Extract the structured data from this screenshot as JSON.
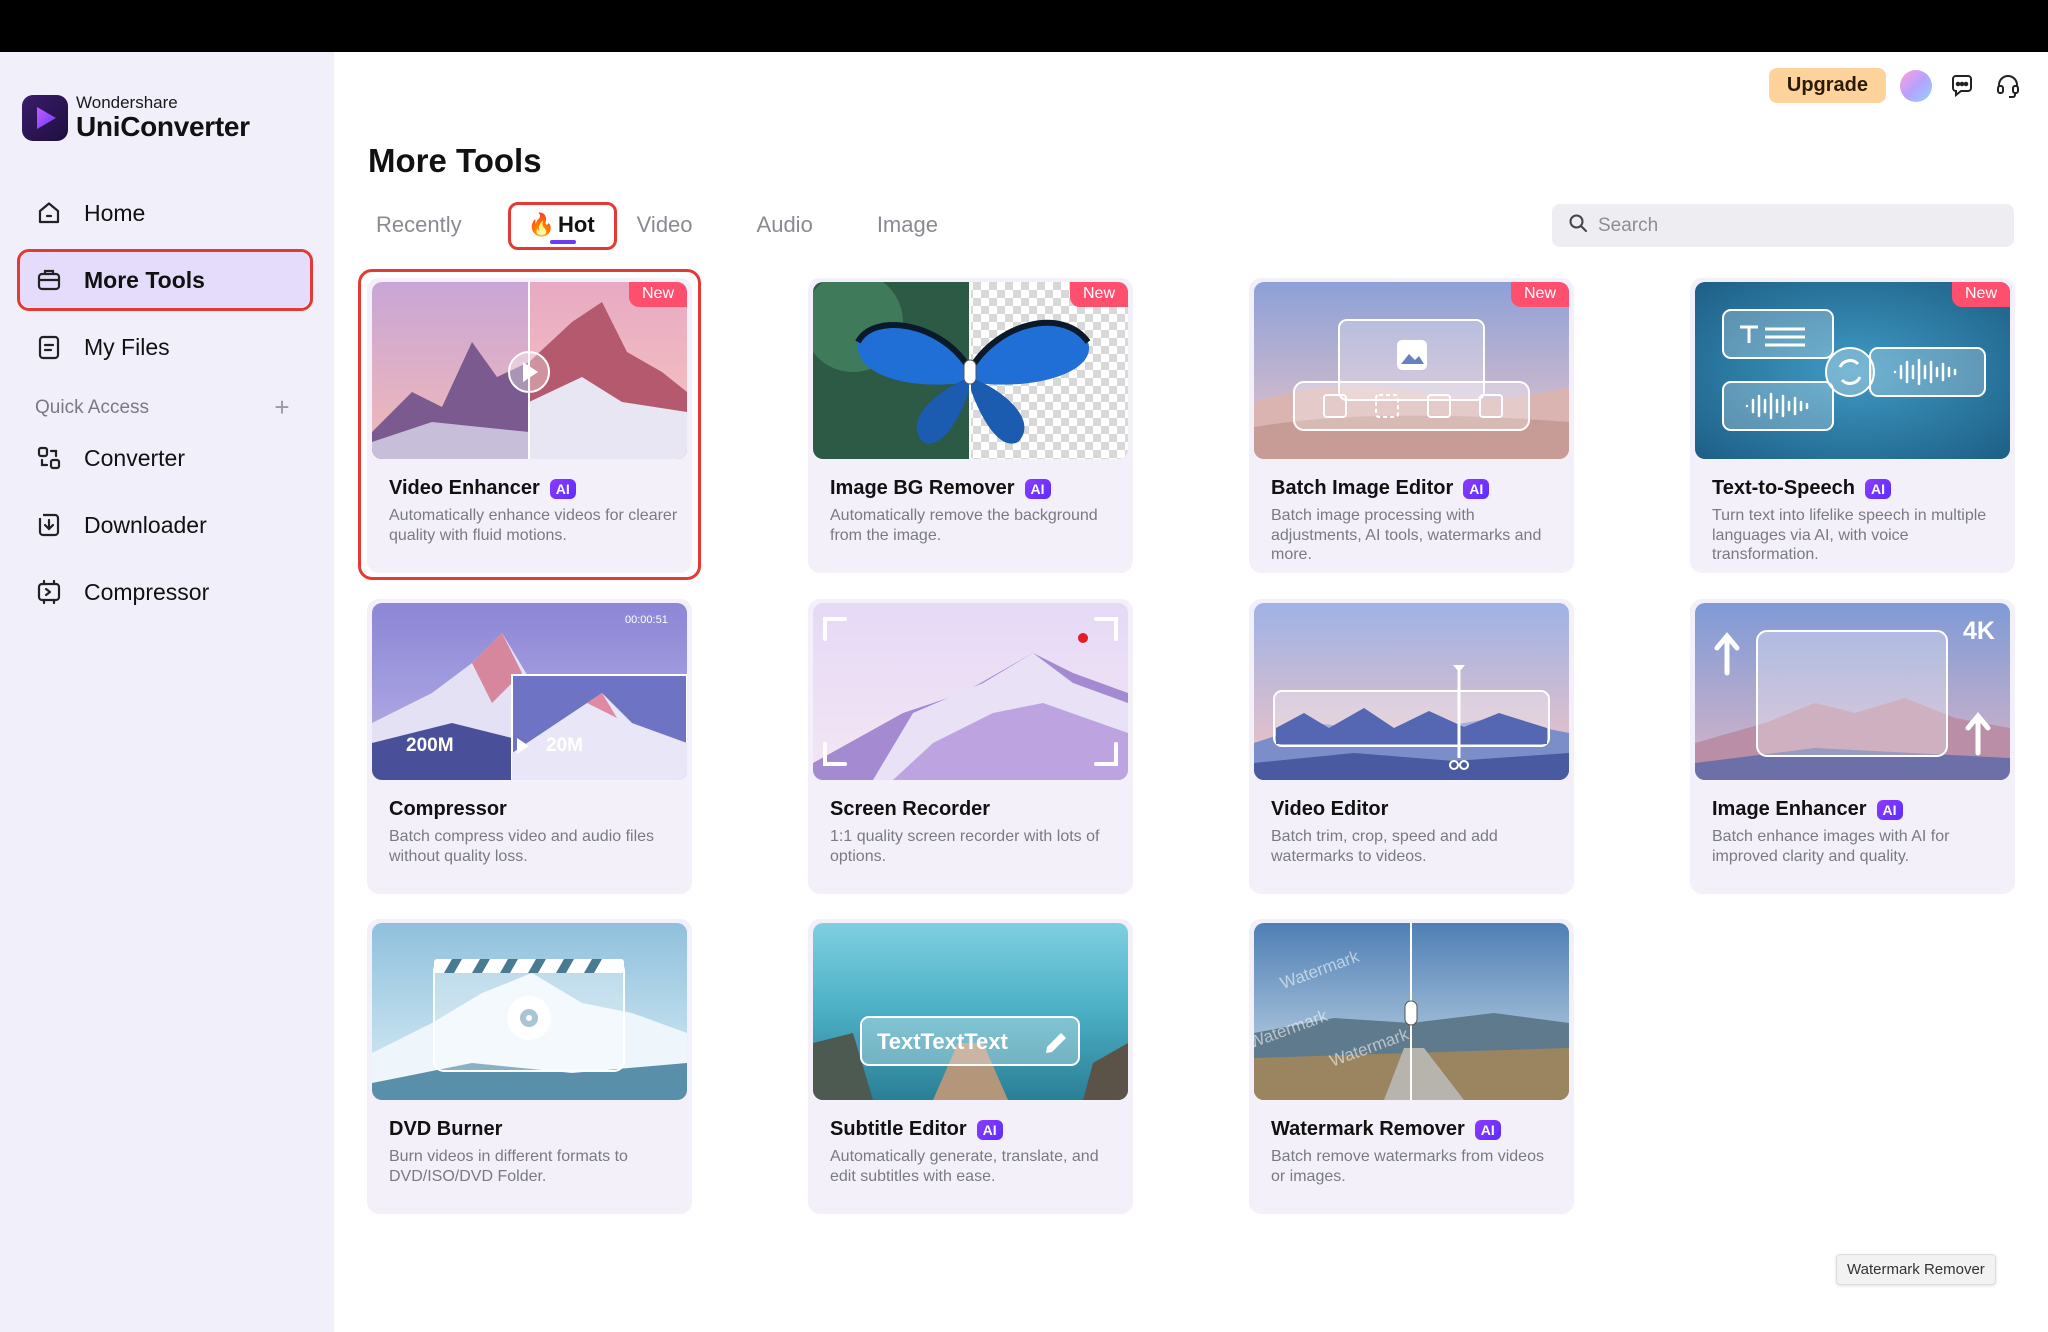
{
  "app": {
    "brand_small": "Wondershare",
    "brand_name": "UniConverter"
  },
  "sidebar": {
    "items": [
      {
        "label": "Home",
        "icon": "home-icon"
      },
      {
        "label": "More Tools",
        "icon": "toolbox-icon",
        "active": true
      },
      {
        "label": "My Files",
        "icon": "file-icon"
      }
    ],
    "quick_access_label": "Quick Access",
    "quick_access_add": "+",
    "quick_items": [
      {
        "label": "Converter",
        "icon": "converter-icon"
      },
      {
        "label": "Downloader",
        "icon": "downloader-icon"
      },
      {
        "label": "Compressor",
        "icon": "compressor-icon"
      }
    ]
  },
  "header": {
    "upgrade_label": "Upgrade"
  },
  "page": {
    "title": "More Tools"
  },
  "tabs": [
    "Recently",
    "Hot",
    "Video",
    "Audio",
    "Image"
  ],
  "search": {
    "placeholder": "Search"
  },
  "new_label": "New",
  "ai_label": "AI",
  "cards": [
    {
      "title": "Video Enhancer",
      "desc": "Automatically enhance videos for clearer quality with fluid motions.",
      "ai": true,
      "new": true
    },
    {
      "title": "Image BG Remover",
      "desc": "Automatically remove the background from the image.",
      "ai": true,
      "new": true
    },
    {
      "title": "Batch Image Editor",
      "desc": "Batch image processing with adjustments, AI tools, watermarks and more.",
      "ai": true,
      "new": true
    },
    {
      "title": "Text-to-Speech",
      "desc": "Turn text into lifelike speech in multiple languages via AI, with voice transformation.",
      "ai": true,
      "new": true
    },
    {
      "title": "Compressor",
      "desc": "Batch compress video and audio files without quality loss.",
      "ai": false,
      "new": false,
      "thumb_text": {
        "time": "00:00:51",
        "before": "200M",
        "after": "20M"
      }
    },
    {
      "title": "Screen Recorder",
      "desc": "1:1 quality screen recorder with lots of options.",
      "ai": false,
      "new": false
    },
    {
      "title": "Video Editor",
      "desc": "Batch trim, crop, speed and add watermarks to videos.",
      "ai": false,
      "new": false
    },
    {
      "title": "Image Enhancer",
      "desc": "Batch enhance images with AI for improved clarity and quality.",
      "ai": true,
      "new": false,
      "thumb_text": {
        "res": "4K"
      }
    },
    {
      "title": "DVD Burner",
      "desc": "Burn videos in different formats to DVD/ISO/DVD Folder.",
      "ai": false,
      "new": false
    },
    {
      "title": "Subtitle Editor",
      "desc": "Automatically generate, translate, and edit subtitles with ease.",
      "ai": true,
      "new": false,
      "thumb_text": {
        "sample": "TextTextText"
      }
    },
    {
      "title": "Watermark Remover",
      "desc": "Batch remove watermarks from videos or images.",
      "ai": true,
      "new": false,
      "thumb_text": {
        "mark": "Watermark"
      }
    }
  ],
  "tooltip": "Watermark Remover"
}
